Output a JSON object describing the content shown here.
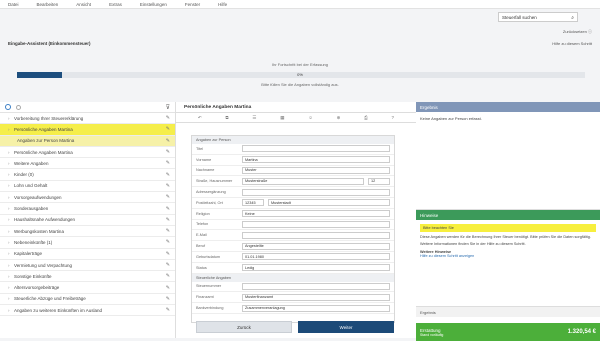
{
  "menu": [
    "Datei",
    "Bearbeiten",
    "Ansicht",
    "Extras",
    "Einstellungen",
    "Fenster",
    "Hilfe"
  ],
  "search": {
    "value": "Steuerfall suchen"
  },
  "topright": {
    "link1": "Zurücksetzen ⓘ",
    "link2": "Hilfe zu diesem Schritt"
  },
  "case": {
    "title": "Eingabe-Assistent (Einkommensteuer)"
  },
  "progress": {
    "label": "Ihr Fortschritt bei der Erfassung",
    "percent": "0%",
    "fraction": 0.08,
    "sub": "Bitte füllen Sie die Angaben vollständig aus."
  },
  "nav": {
    "items": [
      {
        "label": "Vorbereitung Ihrer Steuererklärung"
      },
      {
        "label": "Persönliche Angaben Martina",
        "active": true
      },
      {
        "label": "Angaben zur Person Martina",
        "sub": true
      },
      {
        "label": "Persönliche Angaben Martina"
      },
      {
        "label": "Weitere Angaben"
      },
      {
        "label": "Kinder (0)"
      },
      {
        "label": "Lohn und Gehalt"
      },
      {
        "label": "Vorsorgeaufwendungen"
      },
      {
        "label": "Sonderausgaben"
      },
      {
        "label": "Haushaltsnahe Aufwendungen"
      },
      {
        "label": "Werbungskosten Martina"
      },
      {
        "label": "Nebeneinkünfte (1)"
      },
      {
        "label": "Kapitalerträge"
      },
      {
        "label": "Vermietung und Verpachtung"
      },
      {
        "label": "Sonstige Einkünfte"
      },
      {
        "label": "Altersvorsorgebeiträge"
      },
      {
        "label": "Steuerliche Abzüge und Freibeträge"
      },
      {
        "label": "Angaben zu weiteren Einkünften im Ausland"
      }
    ]
  },
  "middle": {
    "title": "Persönliche Angaben Martina",
    "form": {
      "section1": "Angaben zur Person",
      "rows": [
        {
          "label": "Titel",
          "value": ""
        },
        {
          "label": "Vorname",
          "value": "Martina"
        },
        {
          "label": "Nachname",
          "value": "Muster"
        },
        {
          "label": "Straße, Hausnummer",
          "value": "Musterstraße",
          "value2": "12"
        },
        {
          "label": "Adressergänzung",
          "value": ""
        },
        {
          "label": "Postleitzahl, Ort",
          "value": "12345",
          "value2": "Musterstadt"
        },
        {
          "label": "Religion",
          "value": "Keine"
        },
        {
          "label": "Telefon",
          "value": ""
        },
        {
          "label": "E-Mail",
          "value": ""
        },
        {
          "label": "Beruf",
          "value": "Angestellte"
        },
        {
          "label": "Geburtsdatum",
          "value": "01.01.1980"
        },
        {
          "label": "Status",
          "value": "Ledig"
        }
      ],
      "section2": "Steuerliche Angaben",
      "rows2": [
        {
          "label": "Steuernummer",
          "value": ""
        },
        {
          "label": "Finanzamt",
          "value": "Musterfinanzamt"
        },
        {
          "label": "Bankverbindung",
          "value": "Zusammenveranlagung"
        }
      ]
    },
    "back_label": "Zurück",
    "next_label": "Weiter"
  },
  "right": {
    "header": "Ergebnis",
    "body": "Keine Angaben zur Person erfasst.",
    "info_header": "Hinweise",
    "note": "Bitte beachten Sie",
    "text1": "Diese Angaben werden für die Berechnung Ihrer Steuer benötigt. Bitte prüfen Sie die Daten sorgfältig.",
    "text2": "Weitere Informationen finden Sie in der Hilfe zu diesem Schritt.",
    "section": "Weitere Hinweise",
    "link": "Hilfe zu diesem Schritt anzeigen",
    "result_header": "Ergebnis",
    "result_label": "Erstattung",
    "result_sub": "Stand vorläufig",
    "result_amount": "1.320,54 €"
  }
}
